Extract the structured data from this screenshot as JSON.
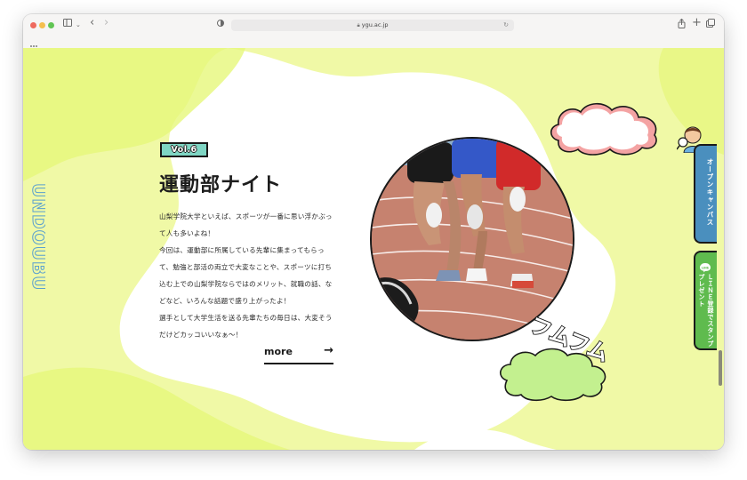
{
  "browser": {
    "url": "ygu.ac.jp",
    "colors": {
      "close": "#ee6a5f",
      "minimize": "#f5bf4f",
      "maximize": "#61c554"
    }
  },
  "section": {
    "vertical_word": "UNDOUBU",
    "badge": "Vol.6",
    "title": "運動部ナイト",
    "paragraphs": [
      "山梨学院大学といえば、スポーツが一番に思い浮かぶって人も多いよね！",
      "今回は、運動部に所属している先輩に集まってもらって、勉強と部活の両立で大変なことや、スポーツに打ち込む上での山梨学院ならではのメリット、就職の話、などなど、いろんな話題で盛り上がったよ！",
      "選手として大学生活を送る先輩たちの毎日は、大変そうだけどカッコいいなぁ～！"
    ],
    "more_label": "more",
    "sfx": "フムフム"
  },
  "side_tabs": {
    "open_campus": "オープンキャンパス",
    "line": "ＬＩＮＥ登録でスタンププレゼント",
    "line_icon_label": "LINE"
  },
  "colors": {
    "page_bg": "#f0f9a6",
    "badge": "#7fd6c4",
    "open_campus_tab": "#4a8fbe",
    "line_tab": "#5fbb4e",
    "cloud_green": "#c3f08f",
    "cloud_pink": "#f4a3a3"
  }
}
